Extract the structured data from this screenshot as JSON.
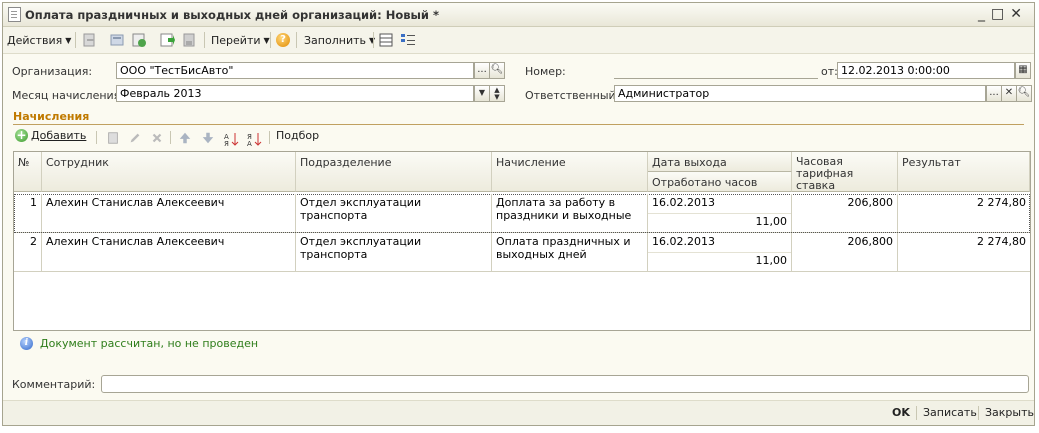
{
  "window": {
    "title": "Оплата праздничных и выходных дней организаций: Новый *",
    "controls": [
      "_",
      "□",
      "✕"
    ]
  },
  "toolbar": {
    "actions_label": "Действия",
    "goto_label": "Перейти",
    "help_label": "?",
    "fill_label": "Заполнить"
  },
  "form": {
    "org_label": "Организация:",
    "org_value": "ООО \"ТестБисАвто\"",
    "number_label": "Номер:",
    "number_value": "",
    "date_label": "от:",
    "date_value": "12.02.2013  0:00:00",
    "month_label": "Месяц начисления:",
    "month_value": "Февраль 2013",
    "responsible_label": "Ответственный:",
    "responsible_value": "Администратор",
    "btn_select": "...",
    "btn_clear": "✕"
  },
  "section": {
    "title": "Начисления",
    "add_label": "Добавить",
    "pick_label": "Подбор"
  },
  "table": {
    "headers": {
      "num": "№",
      "employee": "Сотрудник",
      "department": "Подразделение",
      "accrual": "Начисление",
      "date": "Дата выхода",
      "hours": "Отработано часов",
      "rate": "Часовая тарифная ставка",
      "result": "Результат"
    },
    "rows": [
      {
        "num": "1",
        "employee": "Алехин Станислав Алексеевич",
        "department": "Отдел эксплуатации транспорта",
        "accrual": "Доплата за работу в праздники и выходные",
        "date": "16.02.2013",
        "hours": "11,00",
        "rate": "206,800",
        "result": "2 274,80"
      },
      {
        "num": "2",
        "employee": "Алехин Станислав Алексеевич",
        "department": "Отдел эксплуатации транспорта",
        "accrual": "Оплата праздничных и выходных дней",
        "date": "16.02.2013",
        "hours": "11,00",
        "rate": "206,800",
        "result": "2 274,80"
      }
    ]
  },
  "status": {
    "text": "Документ рассчитан, но не проведен"
  },
  "comment": {
    "label": "Комментарий:",
    "value": ""
  },
  "footer": {
    "ok": "OK",
    "save": "Записать",
    "close": "Закрыть"
  },
  "colors": {
    "accent": "#c07a00",
    "status": "#2e7d1a"
  }
}
